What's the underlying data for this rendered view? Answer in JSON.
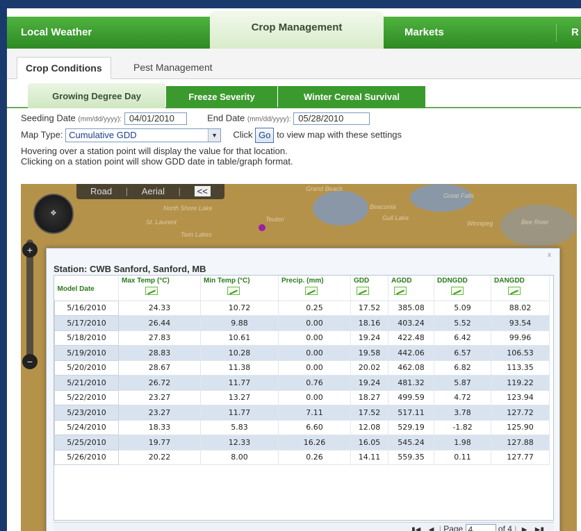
{
  "topnav": {
    "tabs": [
      {
        "label": "Local Weather"
      },
      {
        "label": "Crop Management"
      },
      {
        "label": "Markets"
      },
      {
        "label": "R"
      }
    ]
  },
  "subtabs": [
    {
      "label": "Crop Conditions"
    },
    {
      "label": "Pest Management"
    }
  ],
  "cropTabs": [
    {
      "label": "Growing Degree Day"
    },
    {
      "label": "Freeze Severity"
    },
    {
      "label": "Winter Cereal Survival"
    }
  ],
  "form": {
    "seeding_label": "Seeding Date",
    "seeding_hint": "(mm/dd/yyyy):",
    "seeding_value": "04/01/2010",
    "end_label": "End Date",
    "end_hint": "(mm/dd/yyyy):",
    "end_value": "05/28/2010",
    "maptype_label": "Map Type:",
    "maptype_value": "Cumulative GDD",
    "click_label": "Click",
    "go_label": "Go",
    "go_suffix": "to view map with these settings",
    "hint1": "Hovering over a station point will display the value for that location.",
    "hint2": "Clicking on a station point will show GDD date in table/graph format."
  },
  "map": {
    "road_label": "Road",
    "aerial_label": "Aerial",
    "collapse_label": "<<",
    "places": [
      "Grand Beach",
      "Great Falls",
      "North Shore Lake",
      "St. Laurent",
      "Teulon",
      "Beaconia",
      "Gull Lake",
      "Winnipeg",
      "Bee River",
      "Twin Lakes"
    ]
  },
  "popup": {
    "title": "Station: CWB Sanford, Sanford, MB",
    "close": "x",
    "columns": [
      "Model Date",
      "Max Temp (°C)",
      "Min Temp (°C)",
      "Precip. (mm)",
      "GDD",
      "AGDD",
      "DDNGDD",
      "DANGDD"
    ],
    "rows": [
      [
        "5/16/2010",
        "24.33",
        "10.72",
        "0.25",
        "17.52",
        "385.08",
        "5.09",
        "88.02"
      ],
      [
        "5/17/2010",
        "26.44",
        "9.88",
        "0.00",
        "18.16",
        "403.24",
        "5.52",
        "93.54"
      ],
      [
        "5/18/2010",
        "27.83",
        "10.61",
        "0.00",
        "19.24",
        "422.48",
        "6.42",
        "99.96"
      ],
      [
        "5/19/2010",
        "28.83",
        "10.28",
        "0.00",
        "19.58",
        "442.06",
        "6.57",
        "106.53"
      ],
      [
        "5/20/2010",
        "28.67",
        "11.38",
        "0.00",
        "20.02",
        "462.08",
        "6.82",
        "113.35"
      ],
      [
        "5/21/2010",
        "26.72",
        "11.77",
        "0.76",
        "19.24",
        "481.32",
        "5.87",
        "119.22"
      ],
      [
        "5/22/2010",
        "23.27",
        "13.27",
        "0.00",
        "18.27",
        "499.59",
        "4.72",
        "123.94"
      ],
      [
        "5/23/2010",
        "23.27",
        "11.77",
        "7.11",
        "17.52",
        "517.11",
        "3.78",
        "127.72"
      ],
      [
        "5/24/2010",
        "18.33",
        "5.83",
        "6.60",
        "12.08",
        "529.19",
        "-1.82",
        "125.90"
      ],
      [
        "5/25/2010",
        "19.77",
        "12.33",
        "16.26",
        "16.05",
        "545.24",
        "1.98",
        "127.88"
      ],
      [
        "5/26/2010",
        "20.22",
        "8.00",
        "0.26",
        "14.11",
        "559.35",
        "0.11",
        "127.77"
      ]
    ],
    "pager": {
      "page_label": "Page",
      "page_value": "4",
      "of_label": "of 4"
    }
  }
}
